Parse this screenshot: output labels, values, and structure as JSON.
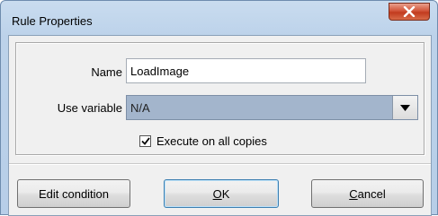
{
  "window": {
    "title": "Rule Properties"
  },
  "form": {
    "name_label": "Name",
    "name_value": "LoadImage",
    "variable_label": "Use variable",
    "variable_value": "N/A",
    "execute_label": "Execute on all copies",
    "execute_checked": true
  },
  "buttons": {
    "edit_condition": "Edit condition",
    "ok_mnemonic": "O",
    "ok_rest": "K",
    "cancel_mnemonic": "C",
    "cancel_rest": "ancel"
  },
  "icons": {
    "close": "close-icon",
    "dropdown": "chevron-down-icon",
    "check": "check-icon"
  },
  "colors": {
    "title_bar": "#bcd2ea",
    "close_button": "#c23b1f",
    "select_background": "#a3b5cc",
    "default_button_border": "#3c7fb1"
  }
}
